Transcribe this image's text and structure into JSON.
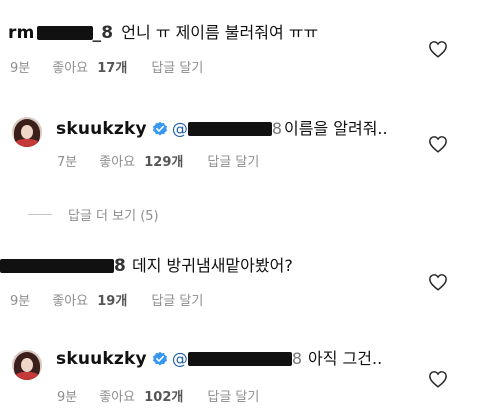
{
  "comments": [
    {
      "username_visible": "rm",
      "username_tail": "_8",
      "text": "언니 ㅠ 제이름 불러줘여 ㅠㅠ",
      "time": "9분",
      "likes_label": "좋아요",
      "likes_count": "17개",
      "reply_label": "답글 달기",
      "heart_icon": "heart-outline-icon"
    },
    {
      "username": "skuukzky",
      "mention_prefix": "@",
      "mention_tail": "8",
      "text": "이름을 알려줘..",
      "time": "7분",
      "likes_label": "좋아요",
      "likes_count": "129개",
      "reply_label": "답글 달기",
      "heart_icon": "heart-outline-icon"
    },
    {
      "username_tail": "8",
      "text": "데지 방귀냄새맡아봤어?",
      "time": "9분",
      "likes_label": "좋아요",
      "likes_count": "19개",
      "reply_label": "답글 달기",
      "heart_icon": "heart-outline-icon"
    },
    {
      "username": "skuukzky",
      "mention_prefix": "@",
      "mention_tail": "8",
      "text": "아직 그건..",
      "time": "9분",
      "likes_label": "좋아요",
      "likes_count": "102개",
      "reply_label": "답글 달기",
      "heart_icon": "heart-outline-icon"
    }
  ],
  "view_more": {
    "label": "답글 더 보기 (5)"
  },
  "colors": {
    "text": "#111111",
    "meta": "#8e8e8e",
    "verified": "#3897f0",
    "mention": "#1f5faa"
  }
}
